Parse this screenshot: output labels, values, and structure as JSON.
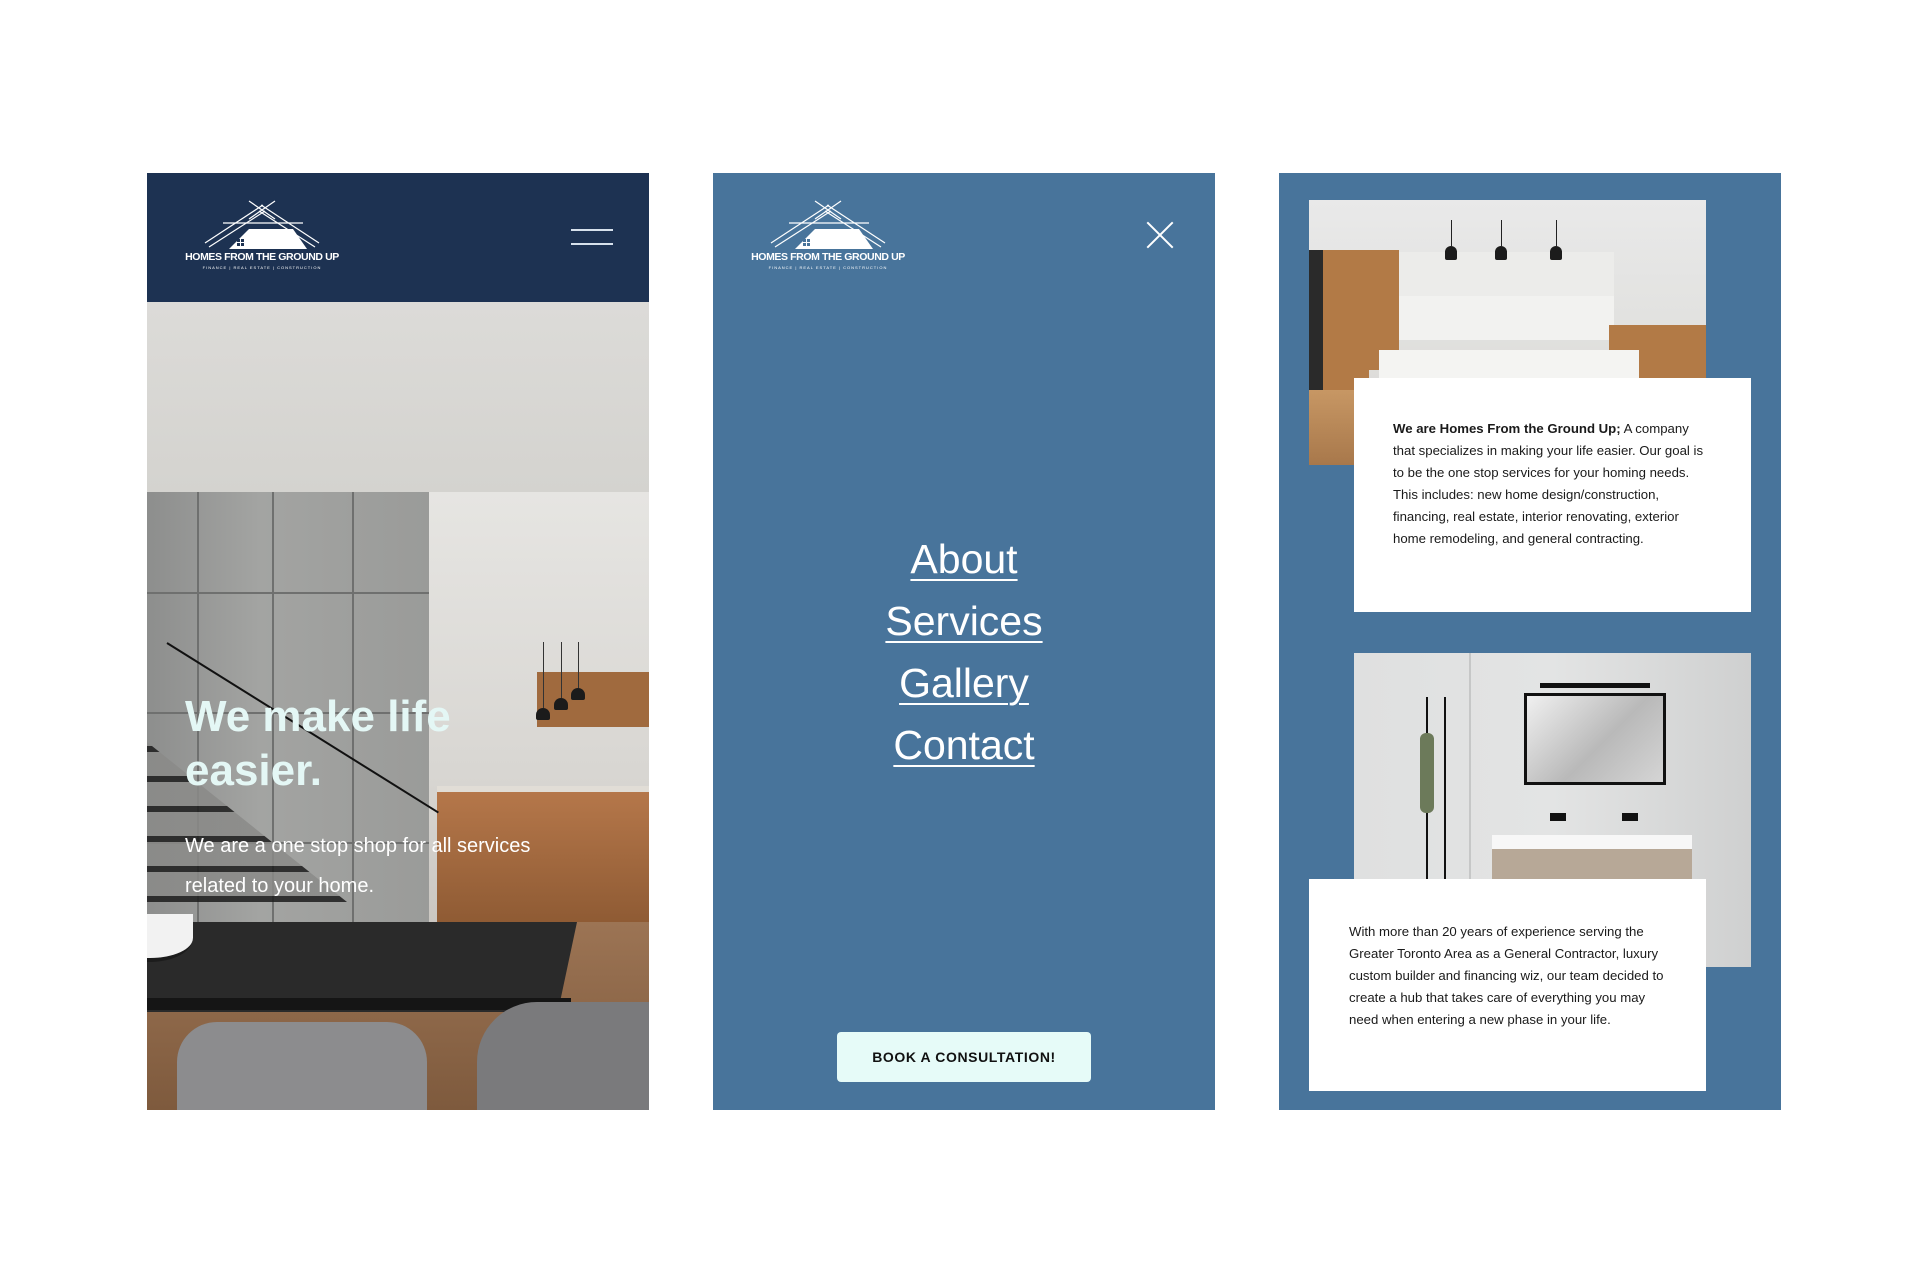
{
  "brand": {
    "name": "HOMES FROM THE GROUND UP",
    "tagline": "FINANCE  |  REAL ESTATE  |  CONSTRUCTION"
  },
  "home_screen": {
    "hero_title": "We make life easier.",
    "hero_subtitle": "We are a one stop shop for all services related to your home."
  },
  "menu_screen": {
    "nav_items": [
      "About",
      "Services",
      "Gallery",
      "Contact"
    ],
    "cta_label": "BOOK A CONSULTATION!"
  },
  "about_screen": {
    "intro_bold": "We are Homes From the Ground Up;",
    "intro_text": " A company that specializes in making your life easier. Our goal is to be the one stop services for your homing needs. This includes: new home design/construction, financing, real estate, interior renovating, exterior home remodeling, and general contracting.",
    "story_text": "With more than 20 years of experience serving the Greater Toronto Area as a General Contractor, luxury custom builder and financing wiz, our team decided to create a hub that takes care of everything you may need when entering a new phase in your life."
  },
  "colors": {
    "navy_header": "#1d3252",
    "menu_blue": "#48749b",
    "hero_title_mint": "#e4f7f5",
    "cta_background": "#e6fbf8"
  },
  "icons": [
    "house-roof-logo-icon",
    "hamburger-menu-icon",
    "close-icon"
  ]
}
